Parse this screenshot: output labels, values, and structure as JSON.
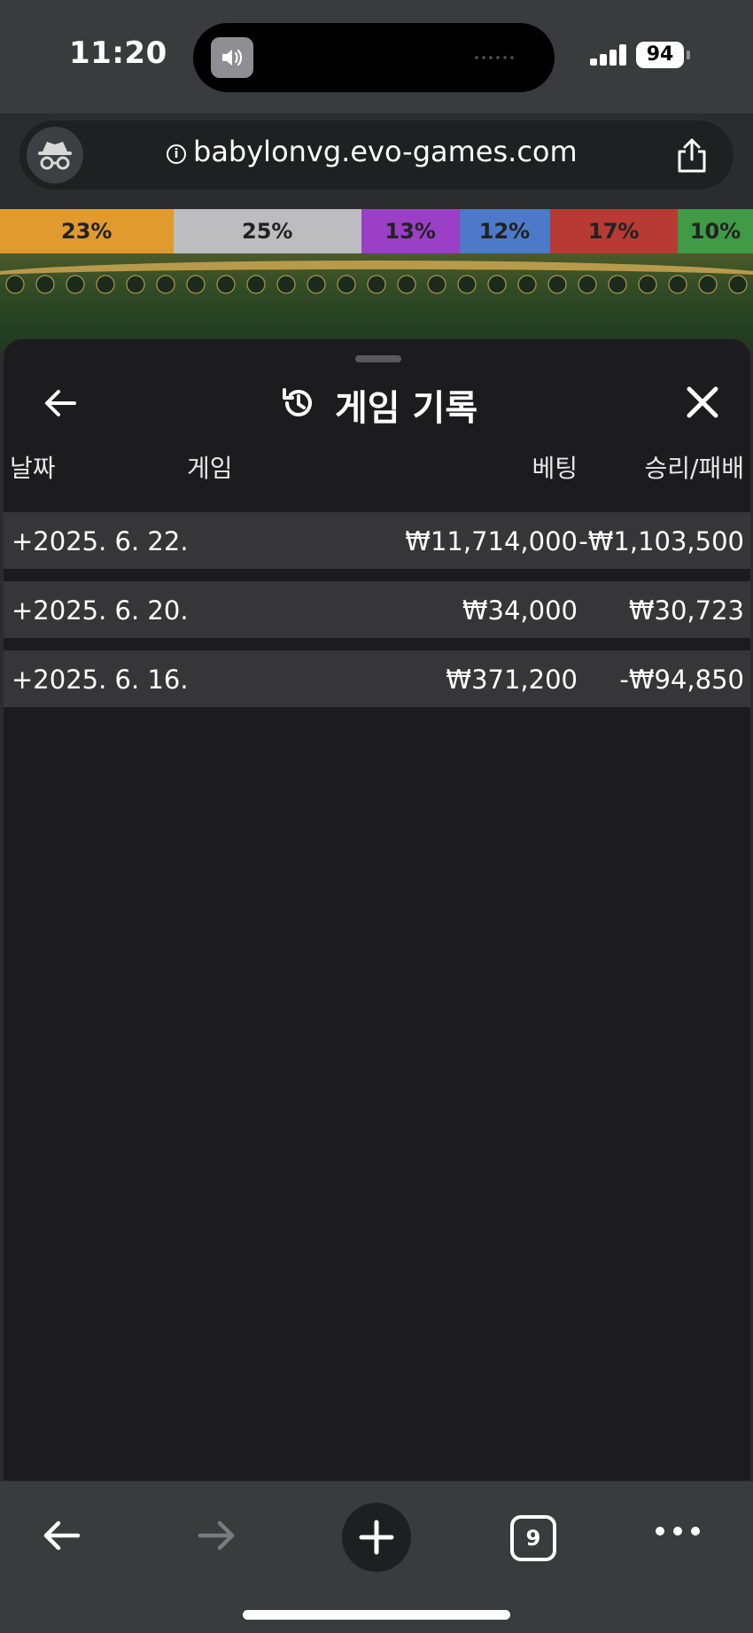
{
  "status_bar": {
    "time": "11:20",
    "battery": "94"
  },
  "browser": {
    "url": "babylonvg.evo-games.com",
    "tab_count": "9"
  },
  "stats_bar": [
    {
      "label": "23%",
      "percent": 23,
      "color": "#e09a2e"
    },
    {
      "label": "25%",
      "percent": 25,
      "color": "#bdbdc0"
    },
    {
      "label": "13%",
      "percent": 13,
      "color": "#9b3fc7"
    },
    {
      "label": "12%",
      "percent": 12,
      "color": "#4c79c8"
    },
    {
      "label": "17%",
      "percent": 17,
      "color": "#b83a34"
    },
    {
      "label": "10%",
      "percent": 10,
      "color": "#3f9b45"
    }
  ],
  "panel": {
    "title": "게임 기록",
    "columns": {
      "date": "날짜",
      "game": "게임",
      "bet": "베팅",
      "win_loss": "승리/패배"
    },
    "rows": [
      {
        "date": "+2025. 6. 22.",
        "game": "",
        "bet": "₩11,714,000",
        "win_loss": "-₩1,103,500"
      },
      {
        "date": "+2025. 6. 20.",
        "game": "",
        "bet": "₩34,000",
        "win_loss": "₩30,723"
      },
      {
        "date": "+2025. 6. 16.",
        "game": "",
        "bet": "₩371,200",
        "win_loss": "-₩94,850"
      }
    ]
  },
  "icons": {
    "status": [
      "volume-icon",
      "signal-icon",
      "battery-icon"
    ],
    "browser": [
      "incognito-icon",
      "info-icon",
      "share-icon"
    ],
    "panel": [
      "back-arrow-icon",
      "history-icon",
      "close-icon"
    ],
    "toolbar": [
      "back-arrow-icon",
      "forward-arrow-icon",
      "plus-icon",
      "tabs-icon",
      "more-icon"
    ]
  }
}
